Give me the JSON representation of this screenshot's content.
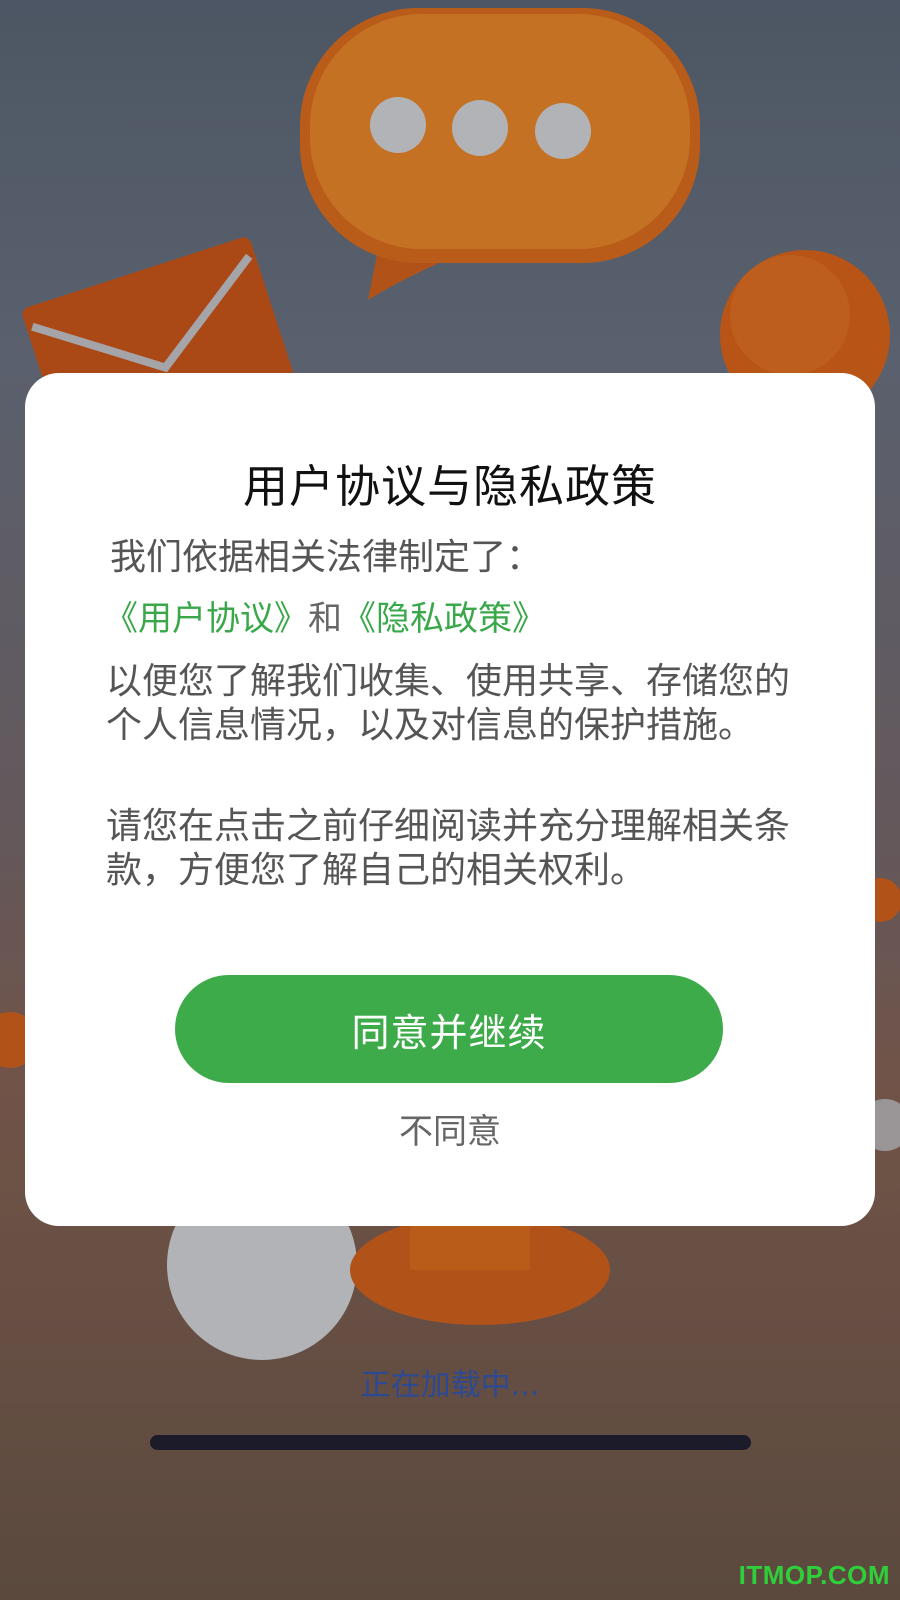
{
  "dialog": {
    "title": "用户协议与隐私政策",
    "intro": "我们依据相关法律制定了：",
    "user_agreement_link": "《用户协议》",
    "conjunction": "和",
    "privacy_policy_link": "《隐私政策》",
    "body_1": "以便您了解我们收集、使用共享、存储您的个人信息情况，以及对信息的保护措施。",
    "body_2": "请您在点击之前仔细阅读并充分理解相关条款，方便您了解自己的相关权利。",
    "agree_label": "同意并继续",
    "disagree_label": "不同意"
  },
  "status": {
    "loading_text": "正在加载中..."
  },
  "watermark": "ITMOP.COM",
  "colors": {
    "accent": "#3dab4a",
    "link": "#3aa84a",
    "loading": "#2c4a93"
  }
}
